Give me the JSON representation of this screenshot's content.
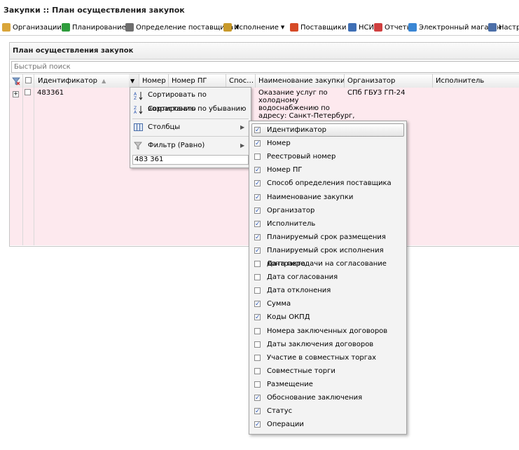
{
  "window": {
    "title": "Закупки :: План осуществления закупок"
  },
  "menu": [
    {
      "label": "Организации",
      "icon": "folder-icon",
      "color": "#d9a53a",
      "has_dropdown": true
    },
    {
      "label": "Планирование",
      "icon": "planning-icon",
      "color": "#2e9c3c",
      "has_dropdown": true
    },
    {
      "label": "Определение поставщика",
      "icon": "gears-icon",
      "color": "#6e6e6e",
      "has_dropdown": true
    },
    {
      "label": "Исполнение",
      "icon": "execution-icon",
      "color": "#c8992a",
      "has_dropdown": true
    },
    {
      "label": "Поставщики",
      "icon": "suppliers-icon",
      "color": "#d64a27",
      "has_dropdown": true
    },
    {
      "label": "НСИ",
      "icon": "nsi-icon",
      "color": "#3f6fb5",
      "has_dropdown": true
    },
    {
      "label": "Отчеты",
      "icon": "report-icon",
      "color": "#d04040",
      "has_dropdown": false
    },
    {
      "label": "Электронный магазин",
      "icon": "cart-icon",
      "color": "#3a86d4",
      "has_dropdown": false
    },
    {
      "label": "Настро",
      "icon": "wrench-icon",
      "color": "#4c6fa8",
      "has_dropdown": false
    }
  ],
  "panel": {
    "title": "План осуществления закупок",
    "search_placeholder": "Быстрый поиск"
  },
  "grid": {
    "columns": [
      "Идентификатор",
      "Номер",
      "Номер ПГ",
      "Спос…",
      "Наименование закупки",
      "Организатор",
      "Исполнитель"
    ],
    "row": {
      "id": "483361",
      "name_lines": [
        "Оказание услуг по",
        "холодному",
        "водоснабжению по",
        "адресу: Санкт-Петербург,"
      ],
      "organizer": "СПб ГБУЗ ГП-24"
    }
  },
  "column_menu": {
    "sort_asc": "Сортировать по возрастанию",
    "sort_desc": "Сортировать по убыванию",
    "columns_label": "Столбцы",
    "filter_label": "Фильтр (Равно)",
    "filter_value": "483 361"
  },
  "columns_list": [
    {
      "label": "Идентификатор",
      "checked": true
    },
    {
      "label": "Номер",
      "checked": true
    },
    {
      "label": "Реестровый номер",
      "checked": false
    },
    {
      "label": "Номер ПГ",
      "checked": true
    },
    {
      "label": "Способ определения поставщика",
      "checked": true
    },
    {
      "label": "Наименование закупки",
      "checked": true
    },
    {
      "label": "Организатор",
      "checked": true
    },
    {
      "label": "Исполнитель",
      "checked": true
    },
    {
      "label": "Планируемый срок размещения",
      "checked": true
    },
    {
      "label": "Планируемый срок исполнения контракта",
      "checked": true
    },
    {
      "label": "Дата передачи на согласование",
      "checked": false
    },
    {
      "label": "Дата согласования",
      "checked": false
    },
    {
      "label": "Дата отклонения",
      "checked": false
    },
    {
      "label": "Сумма",
      "checked": true
    },
    {
      "label": "Коды ОКПД",
      "checked": true
    },
    {
      "label": "Номера заключенных договоров",
      "checked": false
    },
    {
      "label": "Даты заключения договоров",
      "checked": false
    },
    {
      "label": "Участие в совместных торгах",
      "checked": false
    },
    {
      "label": "Совместные торги",
      "checked": false
    },
    {
      "label": "Размещение",
      "checked": false
    },
    {
      "label": "Обоснование заключения",
      "checked": true
    },
    {
      "label": "Статус",
      "checked": true
    },
    {
      "label": "Операции",
      "checked": true
    }
  ]
}
